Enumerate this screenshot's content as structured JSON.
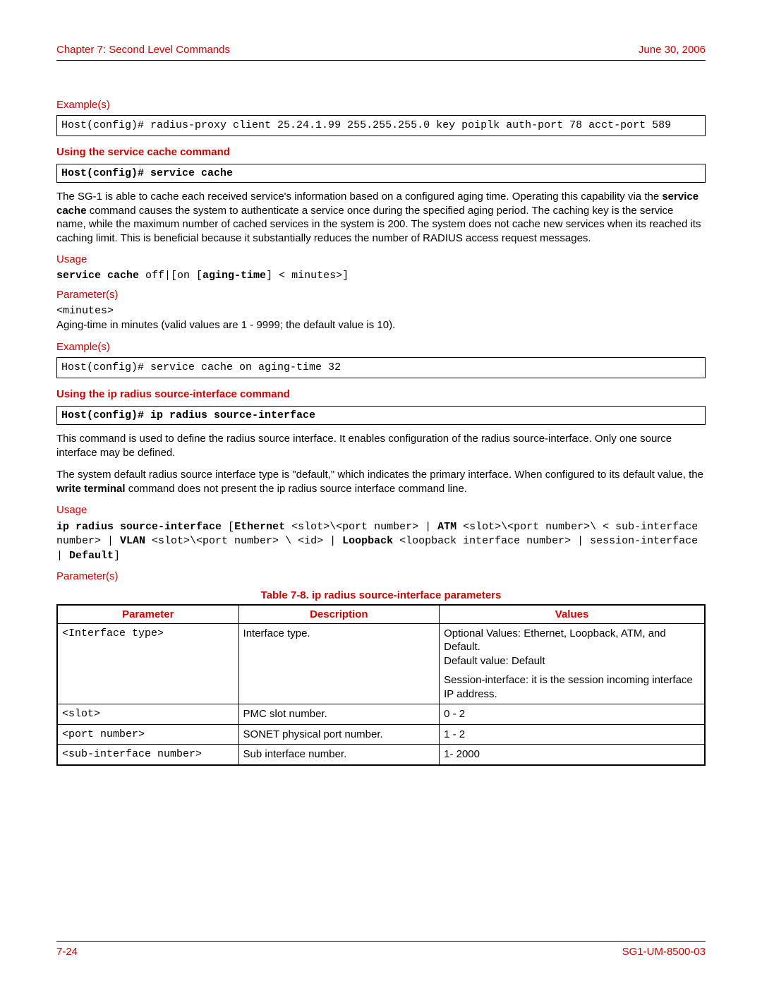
{
  "header": {
    "left": "Chapter 7: Second Level Commands",
    "right": "June 30, 2006"
  },
  "section_examples1": "Example(s)",
  "example1_code": "Host(config)# radius-proxy client 25.24.1.99 255.255.255.0 key poiplk auth-port 78 acct-port 589",
  "svc_cache_heading": "Using the service cache command",
  "svc_cache_cmd": "Host(config)# service cache",
  "svc_cache_para_pre": "The SG-1 is able to cache each received service's information based on a configured aging time. Operating this capability via the ",
  "svc_cache_bold": "service cache",
  "svc_cache_para_post": " command causes the system to authenticate a service once during the specified aging period. The caching key is the service name, while the maximum number of cached services in the system is 200. The system does not cache new services when its reached its caching limit. This is beneficial because it substantially reduces the number of RADIUS access request messages.",
  "usage_label": "Usage",
  "svc_usage_b1": "service cache",
  "svc_usage_p1": " off|[on [",
  "svc_usage_b2": "aging-time",
  "svc_usage_p2": "] < minutes>]",
  "params_label": "Parameter(s)",
  "minutes_label": "<minutes>",
  "minutes_desc": "Aging-time in minutes (valid values are 1 - 9999; the default value is 10).",
  "section_examples2": "Example(s)",
  "example2_code": "Host(config)# service cache on aging-time 32",
  "ip_heading": "Using the ip radius source-interface command",
  "ip_cmd": "Host(config)# ip radius source-interface",
  "ip_para1": "This command is used to define the radius source interface. It enables configuration of the radius source-interface. Only one source interface may be defined.",
  "ip_para2_pre": "The system default radius source interface type is \"default,\" which indicates the primary interface. When configured to its default value, the ",
  "ip_para2_bold": "write terminal",
  "ip_para2_post": " command does not present the ip radius source interface command line.",
  "ip_usage": {
    "b1": "ip radius source-interface",
    "p1": " [",
    "b2": "Ethernet",
    "p2": " <slot>\\<port number> | ",
    "b3": "ATM",
    "p3": " <slot>\\<port number>\\ < sub-interface number> | ",
    "b4": "VLAN",
    "p4": " <slot>\\<port number> \\ <id> | ",
    "b5": "Loopback",
    "p5": " <loopback interface number> | session-interface  | ",
    "b6": "Default",
    "p6": "]"
  },
  "table_caption": "Table 7-8. ip radius source-interface parameters",
  "table": {
    "headers": [
      "Parameter",
      "Description",
      "Values"
    ],
    "rows": [
      {
        "param": "<Interface type>",
        "desc": "Interface type.",
        "vals1": "Optional Values: Ethernet, Loopback, ATM, and Default.\nDefault value: Default",
        "vals2": "Session-interface: it is the session incoming interface IP address."
      },
      {
        "param": "<slot>",
        "desc": "PMC slot number.",
        "vals1": "0 - 2"
      },
      {
        "param": "<port number>",
        "desc": "SONET physical port number.",
        "vals1": "1 - 2"
      },
      {
        "param": "<sub-interface number>",
        "desc": "Sub interface number.",
        "vals1": "1- 2000"
      }
    ]
  },
  "footer": {
    "left": "7-24",
    "right": "SG1-UM-8500-03"
  }
}
